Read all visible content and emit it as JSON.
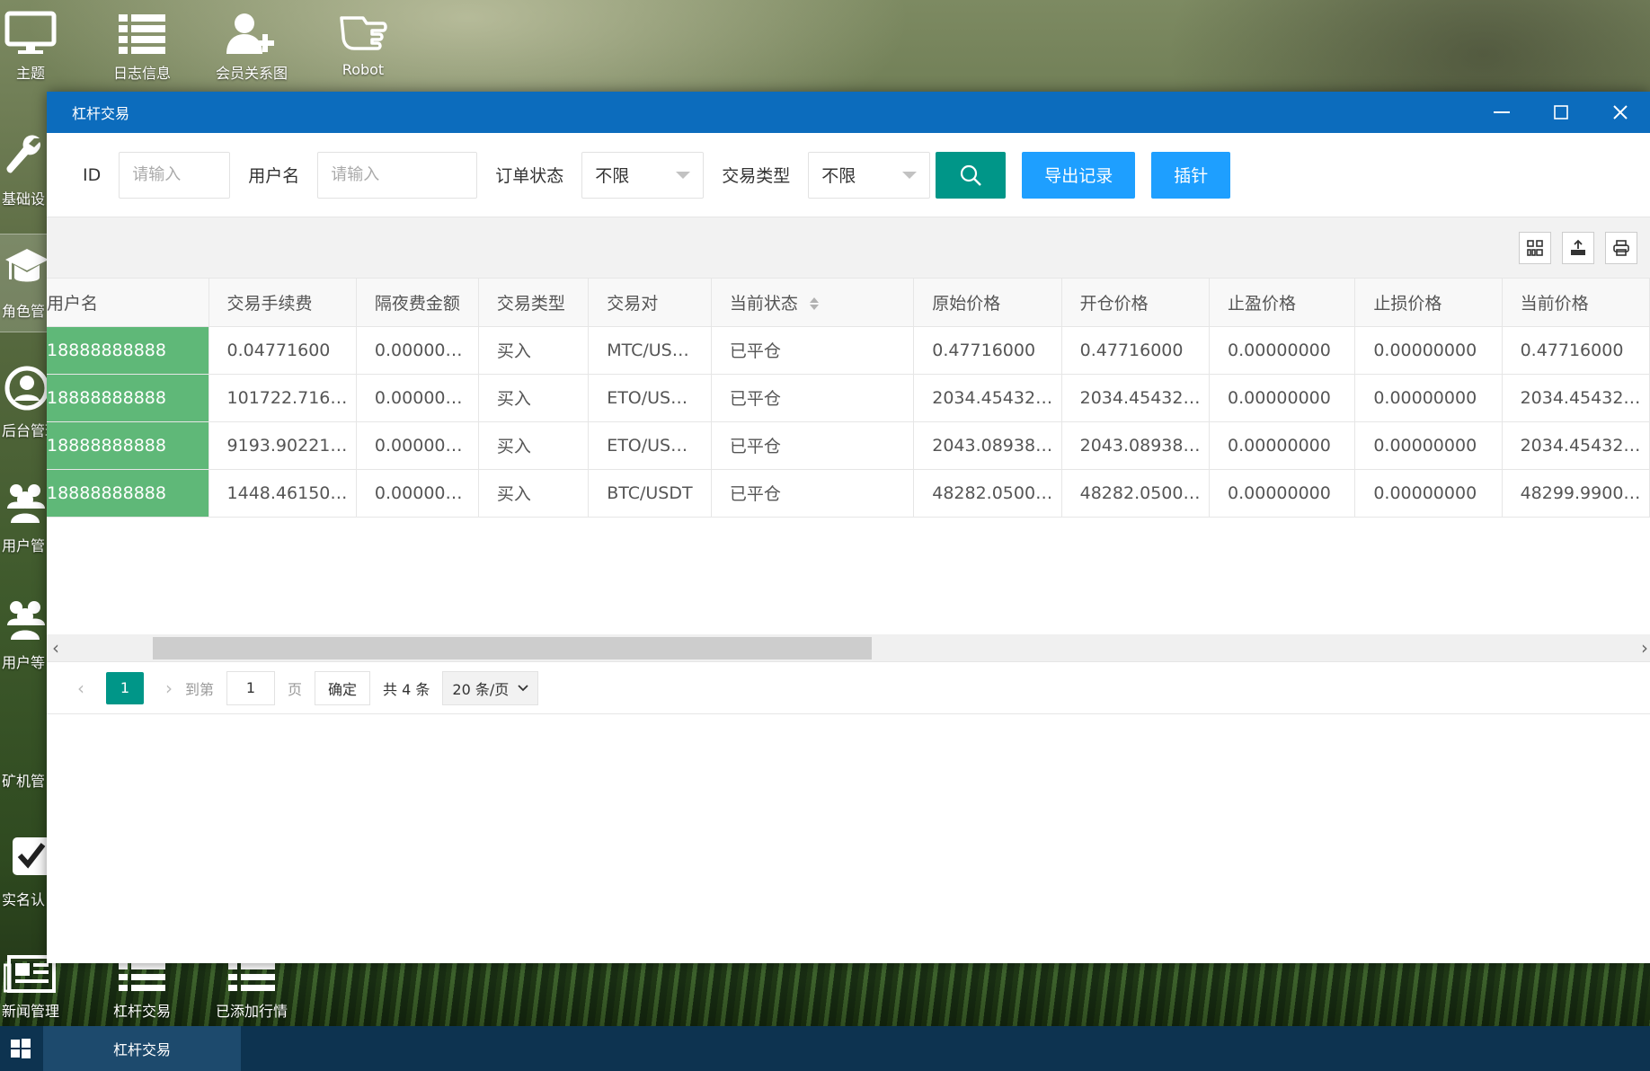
{
  "desktop": {
    "top_icons": [
      {
        "label": "主题",
        "icon": "monitor-icon"
      },
      {
        "label": "日志信息",
        "icon": "list-icon"
      },
      {
        "label": "会员关系图",
        "icon": "add-user-icon"
      },
      {
        "label": "Robot",
        "icon": "robot-hand-icon"
      }
    ],
    "left_icons": [
      {
        "label": "基础设",
        "icon": "wrench-icon"
      },
      {
        "label": "角色管",
        "icon": "graduation-cap-icon"
      },
      {
        "label": "后台管理",
        "icon": "user-circle-icon"
      },
      {
        "label": "用户管",
        "icon": "users-icon"
      },
      {
        "label": "用户等",
        "icon": "users-icon"
      },
      {
        "label": "矿机管",
        "icon": "blank-icon"
      },
      {
        "label": "实名认",
        "icon": "checkbox-icon"
      }
    ],
    "bottom_icons": [
      {
        "label": "新闻管理",
        "icon": "newspaper-icon"
      },
      {
        "label": "杠杆交易",
        "icon": "list-icon"
      },
      {
        "label": "已添加行情",
        "icon": "list-icon"
      }
    ]
  },
  "window": {
    "title": "杠杆交易"
  },
  "filters": {
    "id_label": "ID",
    "id_placeholder": "请输入",
    "username_label": "用户名",
    "username_placeholder": "请输入",
    "order_status_label": "订单状态",
    "order_status_value": "不限",
    "trade_type_label": "交易类型",
    "trade_type_value": "不限",
    "export_label": "导出记录",
    "pin_label": "插针"
  },
  "table": {
    "columns": [
      "用户名",
      "交易手续费",
      "隔夜费金额",
      "交易类型",
      "交易对",
      "当前状态",
      "原始价格",
      "开仓价格",
      "止盈价格",
      "止损价格",
      "当前价格"
    ],
    "rows": [
      [
        "18888888888",
        "0.04771600",
        "0.00000…",
        "买入",
        "MTC/US…",
        "已平仓",
        "0.47716000",
        "0.47716000",
        "0.00000000",
        "0.00000000",
        "0.47716000"
      ],
      [
        "18888888888",
        "101722.716…",
        "0.00000…",
        "买入",
        "ETO/US…",
        "已平仓",
        "2034.45432…",
        "2034.45432…",
        "0.00000000",
        "0.00000000",
        "2034.45432…"
      ],
      [
        "18888888888",
        "9193.90221…",
        "0.00000…",
        "买入",
        "ETO/US…",
        "已平仓",
        "2043.08938…",
        "2043.08938…",
        "0.00000000",
        "0.00000000",
        "2034.45432…"
      ],
      [
        "18888888888",
        "1448.46150…",
        "0.00000…",
        "买入",
        "BTC/USDT",
        "已平仓",
        "48282.0500…",
        "48282.0500…",
        "0.00000000",
        "0.00000000",
        "48299.9900…"
      ]
    ]
  },
  "pager": {
    "current_page": "1",
    "goto_label": "到第",
    "goto_value": "1",
    "page_label": "页",
    "confirm_label": "确定",
    "total_label": "共 4 条",
    "page_size_label": "20 条/页"
  },
  "taskbar": {
    "active_task": "杠杆交易"
  }
}
